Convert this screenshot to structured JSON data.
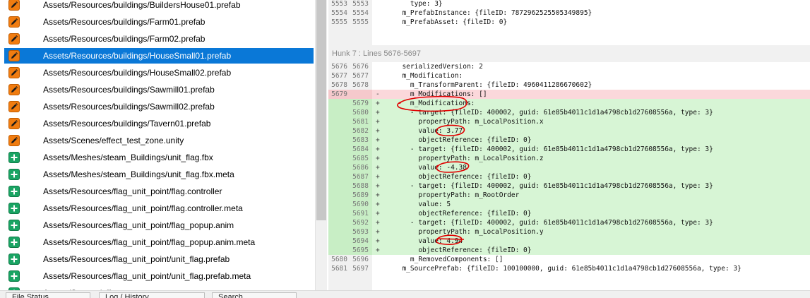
{
  "file_list": [
    {
      "path": "Assets/Resources/buildings/BuildersHouse01.prefab",
      "status": "modified",
      "selected": false
    },
    {
      "path": "Assets/Resources/buildings/Farm01.prefab",
      "status": "modified",
      "selected": false
    },
    {
      "path": "Assets/Resources/buildings/Farm02.prefab",
      "status": "modified",
      "selected": false
    },
    {
      "path": "Assets/Resources/buildings/HouseSmall01.prefab",
      "status": "modified",
      "selected": true
    },
    {
      "path": "Assets/Resources/buildings/HouseSmall02.prefab",
      "status": "modified",
      "selected": false
    },
    {
      "path": "Assets/Resources/buildings/Sawmill01.prefab",
      "status": "modified",
      "selected": false
    },
    {
      "path": "Assets/Resources/buildings/Sawmill02.prefab",
      "status": "modified",
      "selected": false
    },
    {
      "path": "Assets/Resources/buildings/Tavern01.prefab",
      "status": "modified",
      "selected": false
    },
    {
      "path": "Assets/Scenes/effect_test_zone.unity",
      "status": "modified",
      "selected": false
    },
    {
      "path": "Assets/Meshes/steam_Buildings/unit_flag.fbx",
      "status": "added",
      "selected": false
    },
    {
      "path": "Assets/Meshes/steam_Buildings/unit_flag.fbx.meta",
      "status": "added",
      "selected": false
    },
    {
      "path": "Assets/Resources/flag_unit_point/flag.controller",
      "status": "added",
      "selected": false
    },
    {
      "path": "Assets/Resources/flag_unit_point/flag.controller.meta",
      "status": "added",
      "selected": false
    },
    {
      "path": "Assets/Resources/flag_unit_point/flag_popup.anim",
      "status": "added",
      "selected": false
    },
    {
      "path": "Assets/Resources/flag_unit_point/flag_popup.anim.meta",
      "status": "added",
      "selected": false
    },
    {
      "path": "Assets/Resources/flag_unit_point/unit_flag.prefab",
      "status": "added",
      "selected": false
    },
    {
      "path": "Assets/Resources/flag_unit_point/unit_flag.prefab.meta",
      "status": "added",
      "selected": false
    },
    {
      "path": "Assets/Scenes/effect_test_zone_...",
      "status": "added",
      "selected": false
    }
  ],
  "status_icons": {
    "modified": "pencil-icon",
    "added": "plus-icon"
  },
  "colors": {
    "selection": "#0a78d7",
    "modified_icon": "#f07c10",
    "added_icon": "#19a463",
    "added_line": "#d7f5d5",
    "removed_line": "#fbd8db",
    "annotation": "#e00000"
  },
  "diff_top_lines": [
    {
      "old": "5553",
      "new": "5553",
      "marker": "",
      "code": "    type: 3}",
      "kind": "ctx"
    },
    {
      "old": "5554",
      "new": "5554",
      "marker": "",
      "code": "  m_PrefabInstance: {fileID: 7872962525505349895}",
      "kind": "ctx"
    },
    {
      "old": "5555",
      "new": "5555",
      "marker": "",
      "code": "  m_PrefabAsset: {fileID: 0}",
      "kind": "ctx"
    }
  ],
  "hunk_header": "Hunk 7 : Lines 5676-5697",
  "diff_lines": [
    {
      "old": "5676",
      "new": "5676",
      "marker": "",
      "code": "  serializedVersion: 2",
      "kind": "ctx"
    },
    {
      "old": "5677",
      "new": "5677",
      "marker": "",
      "code": "  m_Modification:",
      "kind": "ctx"
    },
    {
      "old": "5678",
      "new": "5678",
      "marker": "",
      "code": "    m_TransformParent: {fileID: 4960411286670602}",
      "kind": "ctx"
    },
    {
      "old": "5679",
      "new": "",
      "marker": "-",
      "code": "    m_Modifications: []",
      "kind": "del"
    },
    {
      "old": "",
      "new": "5679",
      "marker": "+",
      "code": "    m_Modifications:",
      "kind": "add"
    },
    {
      "old": "",
      "new": "5680",
      "marker": "+",
      "code": "    - target: {fileID: 400002, guid: 61e85b4011c1d1a4798cb1d27608556a, type: 3}",
      "kind": "add"
    },
    {
      "old": "",
      "new": "5681",
      "marker": "+",
      "code": "      propertyPath: m_LocalPosition.x",
      "kind": "add"
    },
    {
      "old": "",
      "new": "5682",
      "marker": "+",
      "code": "      value: 3.77",
      "kind": "add"
    },
    {
      "old": "",
      "new": "5683",
      "marker": "+",
      "code": "      objectReference: {fileID: 0}",
      "kind": "add"
    },
    {
      "old": "",
      "new": "5684",
      "marker": "+",
      "code": "    - target: {fileID: 400002, guid: 61e85b4011c1d1a4798cb1d27608556a, type: 3}",
      "kind": "add"
    },
    {
      "old": "",
      "new": "5685",
      "marker": "+",
      "code": "      propertyPath: m_LocalPosition.z",
      "kind": "add"
    },
    {
      "old": "",
      "new": "5686",
      "marker": "+",
      "code": "      value: -4.38",
      "kind": "add"
    },
    {
      "old": "",
      "new": "5687",
      "marker": "+",
      "code": "      objectReference: {fileID: 0}",
      "kind": "add"
    },
    {
      "old": "",
      "new": "5688",
      "marker": "+",
      "code": "    - target: {fileID: 400002, guid: 61e85b4011c1d1a4798cb1d27608556a, type: 3}",
      "kind": "add"
    },
    {
      "old": "",
      "new": "5689",
      "marker": "+",
      "code": "      propertyPath: m_RootOrder",
      "kind": "add"
    },
    {
      "old": "",
      "new": "5690",
      "marker": "+",
      "code": "      value: 5",
      "kind": "add"
    },
    {
      "old": "",
      "new": "5691",
      "marker": "+",
      "code": "      objectReference: {fileID: 0}",
      "kind": "add"
    },
    {
      "old": "",
      "new": "5692",
      "marker": "+",
      "code": "    - target: {fileID: 400002, guid: 61e85b4011c1d1a4798cb1d27608556a, type: 3}",
      "kind": "add"
    },
    {
      "old": "",
      "new": "5693",
      "marker": "+",
      "code": "      propertyPath: m_LocalPosition.y",
      "kind": "add"
    },
    {
      "old": "",
      "new": "5694",
      "marker": "+",
      "code": "      value: 4.94",
      "kind": "add"
    },
    {
      "old": "",
      "new": "5695",
      "marker": "+",
      "code": "      objectReference: {fileID: 0}",
      "kind": "add"
    },
    {
      "old": "5680",
      "new": "5696",
      "marker": "",
      "code": "    m_RemovedComponents: []",
      "kind": "ctx"
    },
    {
      "old": "5681",
      "new": "5697",
      "marker": "",
      "code": "  m_SourcePrefab: {fileID: 100100000, guid: 61e85b4011c1d1a4798cb1d27608556a, type: 3}",
      "kind": "ctx"
    }
  ],
  "bottom_tabs": [
    "File Status",
    "Log / History",
    "Search"
  ]
}
